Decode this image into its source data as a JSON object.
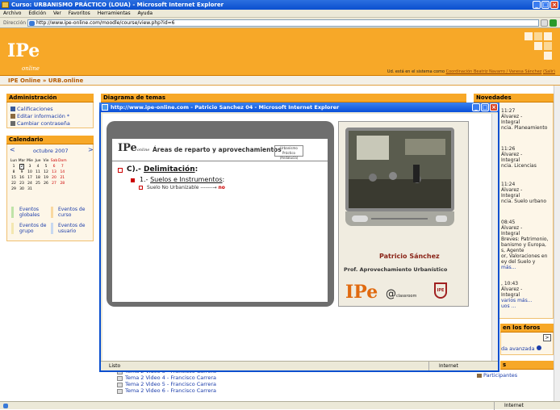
{
  "window": {
    "title": "Curso: URBANISMO PRÁCTICO (LOUA) - Microsoft Internet Explorer",
    "menu": [
      "Archivo",
      "Edición",
      "Ver",
      "Favoritos",
      "Herramientas",
      "Ayuda"
    ],
    "address_label": "Dirección",
    "address": "http://www.ipe-online.com/moodle/course/view.php?id=6",
    "status_zone": "Internet"
  },
  "site": {
    "logo": "IPe",
    "logo_sub": "online",
    "login_prefix": "Ud. está en el sistema como",
    "login_user": "Coordinación Beatriz Navarro / Vanesa Sánchez",
    "logout": "(Salir)",
    "breadcrumb": "IPE Online » URB.online"
  },
  "admin": {
    "title": "Administración",
    "items": [
      "Calificaciones",
      "Editar información *",
      "Cambiar contraseña"
    ]
  },
  "calendar": {
    "title": "Calendario",
    "prev": "<",
    "next": ">",
    "month": "octubre 2007",
    "days": [
      "Lun",
      "Mar",
      "Mie",
      "Jue",
      "Vie",
      "Sab",
      "Dom"
    ],
    "weeks": [
      [
        "1",
        "2",
        "3",
        "4",
        "5",
        "6",
        "7"
      ],
      [
        "8",
        "9",
        "10",
        "11",
        "12",
        "13",
        "14"
      ],
      [
        "15",
        "16",
        "17",
        "18",
        "19",
        "20",
        "21"
      ],
      [
        "22",
        "23",
        "24",
        "25",
        "26",
        "27",
        "28"
      ],
      [
        "29",
        "30",
        "31",
        "",
        "",
        "",
        ""
      ]
    ],
    "today": "2",
    "legend": [
      "Eventos globales",
      "Eventos de curso",
      "Eventos de grupo",
      "Eventos de usuario"
    ]
  },
  "topics": {
    "title": "Diagrama de temas",
    "items": [
      "Tema 2 Video 3 - Francisco Carrera",
      "Tema 2 Video 4 - Francisco Carrera",
      "Tema 2 Video 5 - Francisco Carrera",
      "Tema 2 Video 6 - Francisco Carrera"
    ]
  },
  "news": {
    "title": "Novedades",
    "lines": [
      "11:27",
      "Álvarez -",
      "Integral",
      "ncia. Planeamiento",
      "11:26",
      "Álvarez -",
      "Integral",
      "ncia. Licencias",
      "11:24",
      "Álvarez -",
      "Integral",
      "ncia. Suelo urbano",
      "08:45",
      "Álvarez -",
      "Integral",
      "Breves: Patrimonio,",
      "banismo y Europa,",
      "s, Agente",
      "or, Valoraciones en",
      "ey del Suelo y",
      "más...",
      ", 10:43",
      "Álvarez -",
      "Integral",
      "varios más...",
      "uos ..."
    ],
    "forums_title": "en los foros",
    "search_btn": ">",
    "advanced": "da avanzada",
    "people_title": "s",
    "participants": "Participantes"
  },
  "popup": {
    "title": "http://www.ipe-online.com - Patricio Sanchez 04 - Microsoft Internet Explorer",
    "status": "Listo",
    "zone": "Internet",
    "slide": {
      "logo": "IPe",
      "logo_sub": "online",
      "title": "Áreas de reparto y aprovechamientos",
      "stamp": "Urbanismo Práctico (Andalucía)",
      "heading_prefix": "C).- ",
      "heading": "Delimitación",
      "heading_suffix": ":",
      "sub_prefix": "1.- ",
      "sub": "Suelos e Instrumentos",
      "sub_suffix": ":",
      "bullet": "Suelo No Urbanizable -------→",
      "bullet_result": "no"
    },
    "speaker": {
      "name": "Patricio Sánchez",
      "role": "Prof. Aprovechamiento Urbanístico",
      "logo1": "IPe",
      "logo2": "@",
      "logo2_sub": "classroom",
      "logo3": "IPE"
    }
  }
}
